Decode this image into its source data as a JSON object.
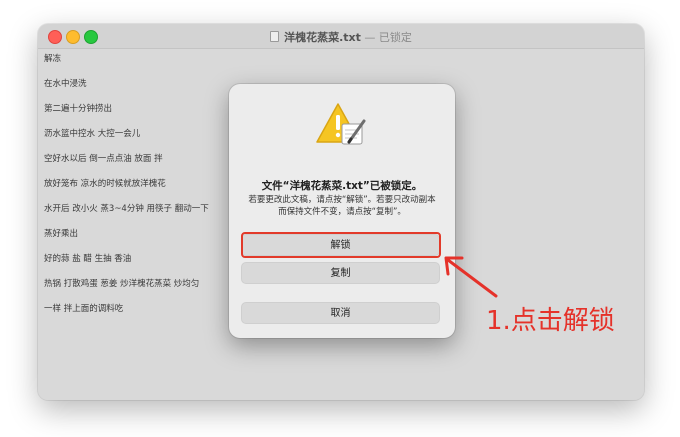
{
  "window": {
    "title": "洋槐花蒸菜.txt",
    "title_separator": "—",
    "title_status": "已锁定"
  },
  "document": {
    "lines": [
      "解冻",
      "在水中浸洗",
      "第二遍十分钟捞出",
      "沥水篮中控水 大控一会儿",
      "空好水以后 倒一点点油 放面 拌",
      "放好笼布 凉水的时候就放洋槐花",
      "水开后 改小火 蒸3~4分钟 用筷子 翻动一下",
      "蒸好乘出",
      "好的蒜 盐 醋 生抽 香油",
      "热锅 打散鸡蛋 葱姜 炒洋槐花蒸菜 炒均匀",
      "一样 拌上面的调料吃"
    ]
  },
  "dialog": {
    "icon": "warning-pencil-icon",
    "title": "文件“洋槐花蒸菜.txt”已被锁定。",
    "message": "若要更改此文稿，请点按“解锁”。若要只改动副本而保持文件不变，请点按“复制”。",
    "unlock_label": "解锁",
    "copy_label": "复制",
    "cancel_label": "取消"
  },
  "annotation": {
    "text": "1.点击解锁",
    "color": "#e5322a"
  }
}
